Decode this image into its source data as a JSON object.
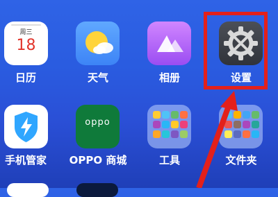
{
  "apps": [
    {
      "id": "calendar",
      "label": "日历",
      "weekday": "周三",
      "date": "18",
      "icon": "calendar-icon"
    },
    {
      "id": "weather",
      "label": "天气",
      "icon": "weather-icon"
    },
    {
      "id": "photos",
      "label": "相册",
      "icon": "photos-icon"
    },
    {
      "id": "settings",
      "label": "设置",
      "icon": "gear-icon"
    },
    {
      "id": "phone-manager",
      "label": "手机管家",
      "icon": "shield-lightning-icon"
    },
    {
      "id": "oppo-store",
      "label": "OPPO 商城",
      "icon_text": "oppo",
      "icon": "oppo-store-icon"
    },
    {
      "id": "tools",
      "label": "工具",
      "icon": "tools-folder-icon"
    },
    {
      "id": "folder",
      "label": "文件夹",
      "icon": "folder-icon"
    }
  ],
  "colors": {
    "highlight": "#e3201b",
    "wallpaper_top": "#2f63e6",
    "wallpaper_bottom": "#1f3fb8"
  }
}
